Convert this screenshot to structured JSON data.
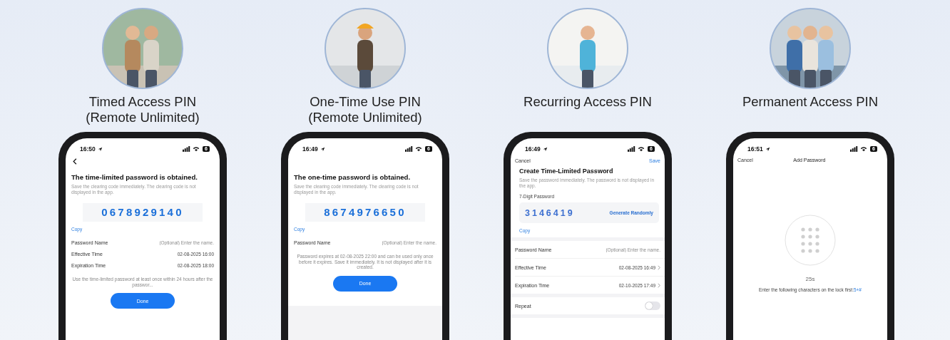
{
  "panels": [
    {
      "title": [
        "Timed Access PIN",
        "(Remote Unlimited)"
      ],
      "screen": {
        "kind": "result",
        "time": "16:50",
        "battery": "6",
        "back": true,
        "heading": "The time-limited password is obtained.",
        "subtext": "Save the clearing code immediately. The clearing code is not displayed in the app.",
        "code": "0678929140",
        "copy": "Copy",
        "rows": [
          {
            "label": "Password Name",
            "placeholder": "(Optional) Enter the name."
          },
          {
            "label": "Effective Time",
            "value": "02-08-2025 16:00"
          },
          {
            "label": "Expiration Time",
            "value": "02-08-2025 18:00"
          }
        ],
        "note": "Use the time-limited password at least once within 24 hours after the passwor...",
        "button": "Done",
        "gray_footer": false
      }
    },
    {
      "title": [
        "One-Time Use PIN",
        "(Remote Unlimited)"
      ],
      "screen": {
        "kind": "result",
        "time": "16:49",
        "battery": "6",
        "back": false,
        "heading": "The one-time password is obtained.",
        "subtext": "Save the clearing code immediately. The clearing code is not displayed in the app.",
        "code": "8674976650",
        "copy": "Copy",
        "rows": [
          {
            "label": "Password Name",
            "placeholder": "(Optional) Enter the name."
          }
        ],
        "note": "Password expires at 02-08-2025 22:00 and can be used only once before it expires. Save it immediately. It is not displayed after it is created.",
        "button": "Done",
        "gray_footer": true
      }
    },
    {
      "title": [
        "Recurring Access PIN"
      ],
      "screen": {
        "kind": "create",
        "time": "16:49",
        "battery": "6",
        "cancel": "Cancel",
        "save": "Save",
        "heading": "Create Time-Limited Password",
        "subtext": "Save the password immediately. The password is not displayed in the app.",
        "field_label": "7-Digit Password",
        "code": "3146419",
        "generate": "Generate Randomly",
        "copy": "Copy",
        "rows": [
          {
            "label": "Password Name",
            "placeholder": "(Optional) Enter the name.",
            "chevron": false
          },
          {
            "label": "Effective Time",
            "value": "02-08-2025 16:49",
            "chevron": true
          },
          {
            "label": "Expiration Time",
            "value": "02-10-2025 17:49",
            "chevron": true
          }
        ],
        "toggle": {
          "label": "Repeat",
          "on": false
        }
      }
    },
    {
      "title": [
        "Permanent Access PIN"
      ],
      "screen": {
        "kind": "add",
        "time": "16:51",
        "battery": "6",
        "cancel": "Cancel",
        "title": "Add Password",
        "countdown": "25s",
        "instruction": "Enter the following characters on the lock first:",
        "lock_code": "5+#"
      }
    }
  ]
}
